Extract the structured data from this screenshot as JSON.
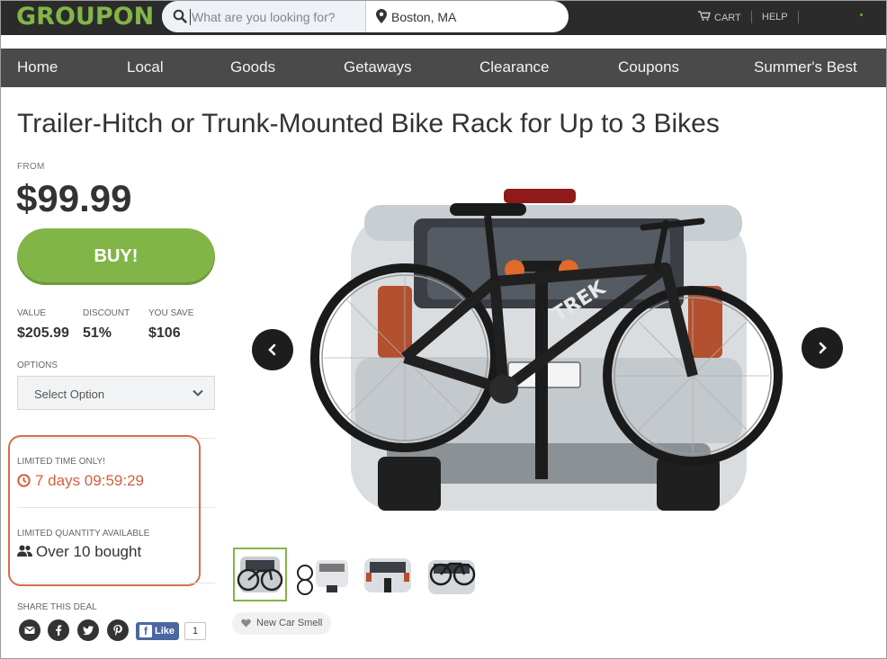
{
  "header": {
    "logo": "GROUPON",
    "search_placeholder": "What are you looking for?",
    "location": "Boston, MA",
    "cart_label": "CART",
    "help_label": "HELP"
  },
  "nav": {
    "items": [
      "Home",
      "Local",
      "Goods",
      "Getaways",
      "Clearance",
      "Coupons",
      "Summer's Best"
    ]
  },
  "deal": {
    "title": "Trailer-Hitch or Trunk-Mounted Bike Rack for Up to 3 Bikes",
    "from_label": "FROM",
    "price": "$99.99",
    "buy_label": "BUY!",
    "stats": [
      {
        "label": "VALUE",
        "value": "$205.99"
      },
      {
        "label": "DISCOUNT",
        "value": "51%"
      },
      {
        "label": "YOU SAVE",
        "value": "$106"
      }
    ],
    "options_label": "OPTIONS",
    "select_value": "Select Option",
    "limited_time_label": "LIMITED TIME ONLY!",
    "countdown": "7 days 09:59:29",
    "limited_quantity_label": "LIMITED QUANTITY AVAILABLE",
    "bought": "Over 10 bought",
    "share_label": "SHARE THIS DEAL",
    "fb_like_label": "Like",
    "fb_count": "1",
    "tag_label": "New Car Smell"
  },
  "colors": {
    "brand_green": "#82b548",
    "countdown_orange": "#d35f3f",
    "highlight_outline": "#d56d4c",
    "topbar": "#2b2b2b",
    "navbar": "#4a4a4a"
  },
  "icons": [
    "search-icon",
    "location-pin-icon",
    "cart-icon",
    "chevron-down-icon",
    "clock-icon",
    "users-icon",
    "email-icon",
    "facebook-icon",
    "twitter-icon",
    "pinterest-icon",
    "arrow-left-icon",
    "arrow-right-icon",
    "heart-icon"
  ]
}
